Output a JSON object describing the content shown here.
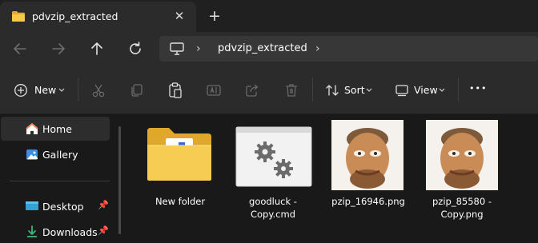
{
  "tab": {
    "title": "pdvzip_extracted",
    "close_glyph": "✕",
    "new_glyph": "+"
  },
  "address": {
    "path": "pdvzip_extracted"
  },
  "toolbar": {
    "new_label": "New",
    "sort_label": "Sort",
    "view_label": "View",
    "more_glyph": "•••"
  },
  "sidebar": {
    "items": [
      {
        "label": "Home",
        "icon": "home-icon"
      },
      {
        "label": "Gallery",
        "icon": "gallery-icon"
      },
      {
        "label": "Desktop",
        "icon": "desktop-icon"
      },
      {
        "label": "Downloads",
        "icon": "downloads-icon"
      }
    ]
  },
  "files": [
    {
      "name": "New folder",
      "icon": "folder-icon"
    },
    {
      "name": "goodluck -\nCopy.cmd",
      "icon": "cmd-file-icon"
    },
    {
      "name": "pzip_16946.png",
      "icon": "image-thumbnail"
    },
    {
      "name": "pzip_85580 -\nCopy.png",
      "icon": "image-thumbnail"
    }
  ],
  "colors": {
    "accent": "#4cc2ff",
    "folder": "#f4c542",
    "background": "#191919",
    "panel": "#2b2b2b"
  }
}
